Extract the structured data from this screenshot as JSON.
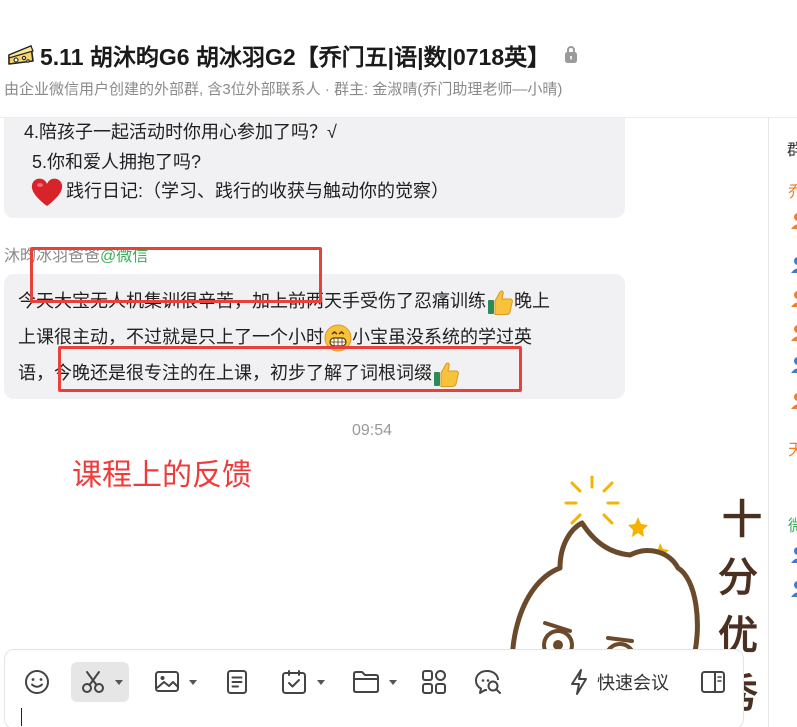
{
  "header": {
    "title": "5.11 胡沐昀G6 胡冰羽G2【乔门五|语|数|0718英】",
    "subtitle": "由企业微信用户创建的外部群, 含3位外部联系人 · 群主: 金淑晴(乔门助理老师—小晴)",
    "title_icon": "cheese-icon",
    "lock_icon": "lock-icon"
  },
  "messages": {
    "msg1": {
      "line1": "4.陪孩子一起活动时你用心参加了吗？√",
      "line2": "5.你和爱人拥抱了吗?",
      "line3": "践行日记:（学习、践行的收获与触动你的觉察）",
      "icon": "heart-icon"
    },
    "msg2": {
      "sender": "沐昀冰羽爸爸",
      "sender_source": "@微信",
      "line1_a": "今天大宝无人机集训很辛苦，加上前两天手受伤了忍痛训练",
      "line1_b": "晚上",
      "line2_a": "上课很主动，不过就是只上了一个小时",
      "line2_b": "小宝虽没系统的学过英",
      "line3": "语，今晚还是很专注的在上课，初步了解了词根词缀"
    },
    "time": "09:54",
    "annotation": "课程上的反馈"
  },
  "sticker": {
    "text": [
      "十",
      "分",
      "优",
      "秀"
    ]
  },
  "side_panel": {
    "header": "群",
    "items": [
      "乔",
      "天",
      "微"
    ],
    "colors": {
      "orange": "#f07f2a",
      "blue": "#3a7bd5",
      "green": "#3dae5a"
    }
  },
  "toolbar": {
    "quick_meeting_label": "快速会议",
    "icons": [
      "emoji-icon",
      "scissors-icon",
      "image-icon",
      "document-icon",
      "calendar-check-icon",
      "folder-icon",
      "apps-grid-icon",
      "chat-search-icon",
      "lightning-icon",
      "sidebar-toggle-icon"
    ]
  },
  "colors": {
    "bubble": "#f1f1f3",
    "annotation_red": "#ef3b3b",
    "highlight_box": "#e8413c"
  }
}
